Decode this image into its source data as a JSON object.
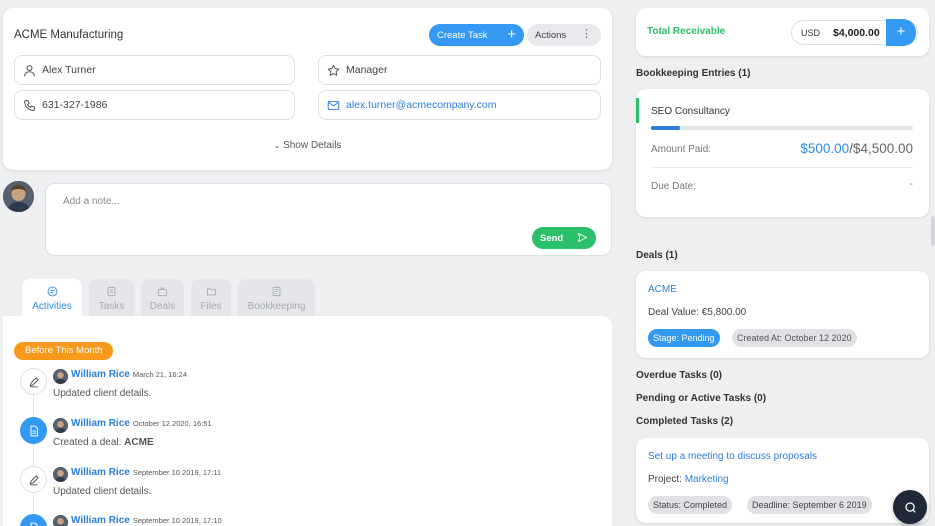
{
  "company": {
    "name": "ACME Manufacturing",
    "create_task_label": "Create Task",
    "actions_label": "Actions",
    "contact_name": "Alex Turner",
    "role": "Manager",
    "phone": "631-327-1986",
    "email": "alex.turner@acmecompany.com",
    "show_details_label": "Show Details"
  },
  "note": {
    "placeholder": "Add a note...",
    "send_label": "Send"
  },
  "tabs": [
    {
      "label": "Activities",
      "icon": "activities-icon",
      "active": true
    },
    {
      "label": "Tasks",
      "icon": "tasks-icon",
      "active": false
    },
    {
      "label": "Deals",
      "icon": "deals-icon",
      "active": false
    },
    {
      "label": "Files",
      "icon": "files-icon",
      "active": false
    },
    {
      "label": "Bookkeeping",
      "icon": "bookkeeping-icon",
      "active": false
    }
  ],
  "timeline": {
    "group_label": "Before This Month",
    "items": [
      {
        "user": "William Rice",
        "time": "March 21, 16:24",
        "desc": "Updated client details.",
        "desc_strong": "",
        "icon": "edit-icon"
      },
      {
        "user": "William Rice",
        "time": "October 12 2020, 16:51",
        "desc": "Created a deal: ",
        "desc_strong": "ACME",
        "icon": "document-icon"
      },
      {
        "user": "William Rice",
        "time": "September 10 2019, 17:11",
        "desc": "Updated client details.",
        "desc_strong": "",
        "icon": "edit-icon"
      },
      {
        "user": "William Rice",
        "time": "September 10 2019, 17:10",
        "desc": "",
        "desc_strong": "",
        "icon": "document-icon"
      }
    ]
  },
  "receivable": {
    "label": "Total Receivable",
    "currency": "USD",
    "amount": "$4,000.00",
    "add_label": "+"
  },
  "bookkeeping": {
    "section_title": "Bookkeeping Entries (1)",
    "entry_title": "SEO Consultancy",
    "progress": 0.11,
    "amount_paid_label": "Amount Paid:",
    "amount_paid": "$500.00",
    "amount_total": "/$4,500.00",
    "due_date_label": "Due Date:",
    "due_date": "-"
  },
  "deals": {
    "section_title": "Deals (1)",
    "deal_name": "ACME",
    "deal_value": "Deal Value: €5,800.00",
    "stage": "Stage: Pending",
    "created": "Created At: October 12 2020"
  },
  "tasks": {
    "overdue": "Overdue Tasks (0)",
    "pending": "Pending or Active Tasks (0)",
    "completed": "Completed Tasks (2)",
    "task_title": "Set up a meeting to discuss proposals",
    "project_label": "Project: ",
    "project_name": "Marketing",
    "status": "Status: Completed",
    "deadline": "Deadline: September 6 2019"
  },
  "colors": {
    "accent": "#3399f3",
    "green": "#2bc06a",
    "orange": "#f79a1c"
  }
}
